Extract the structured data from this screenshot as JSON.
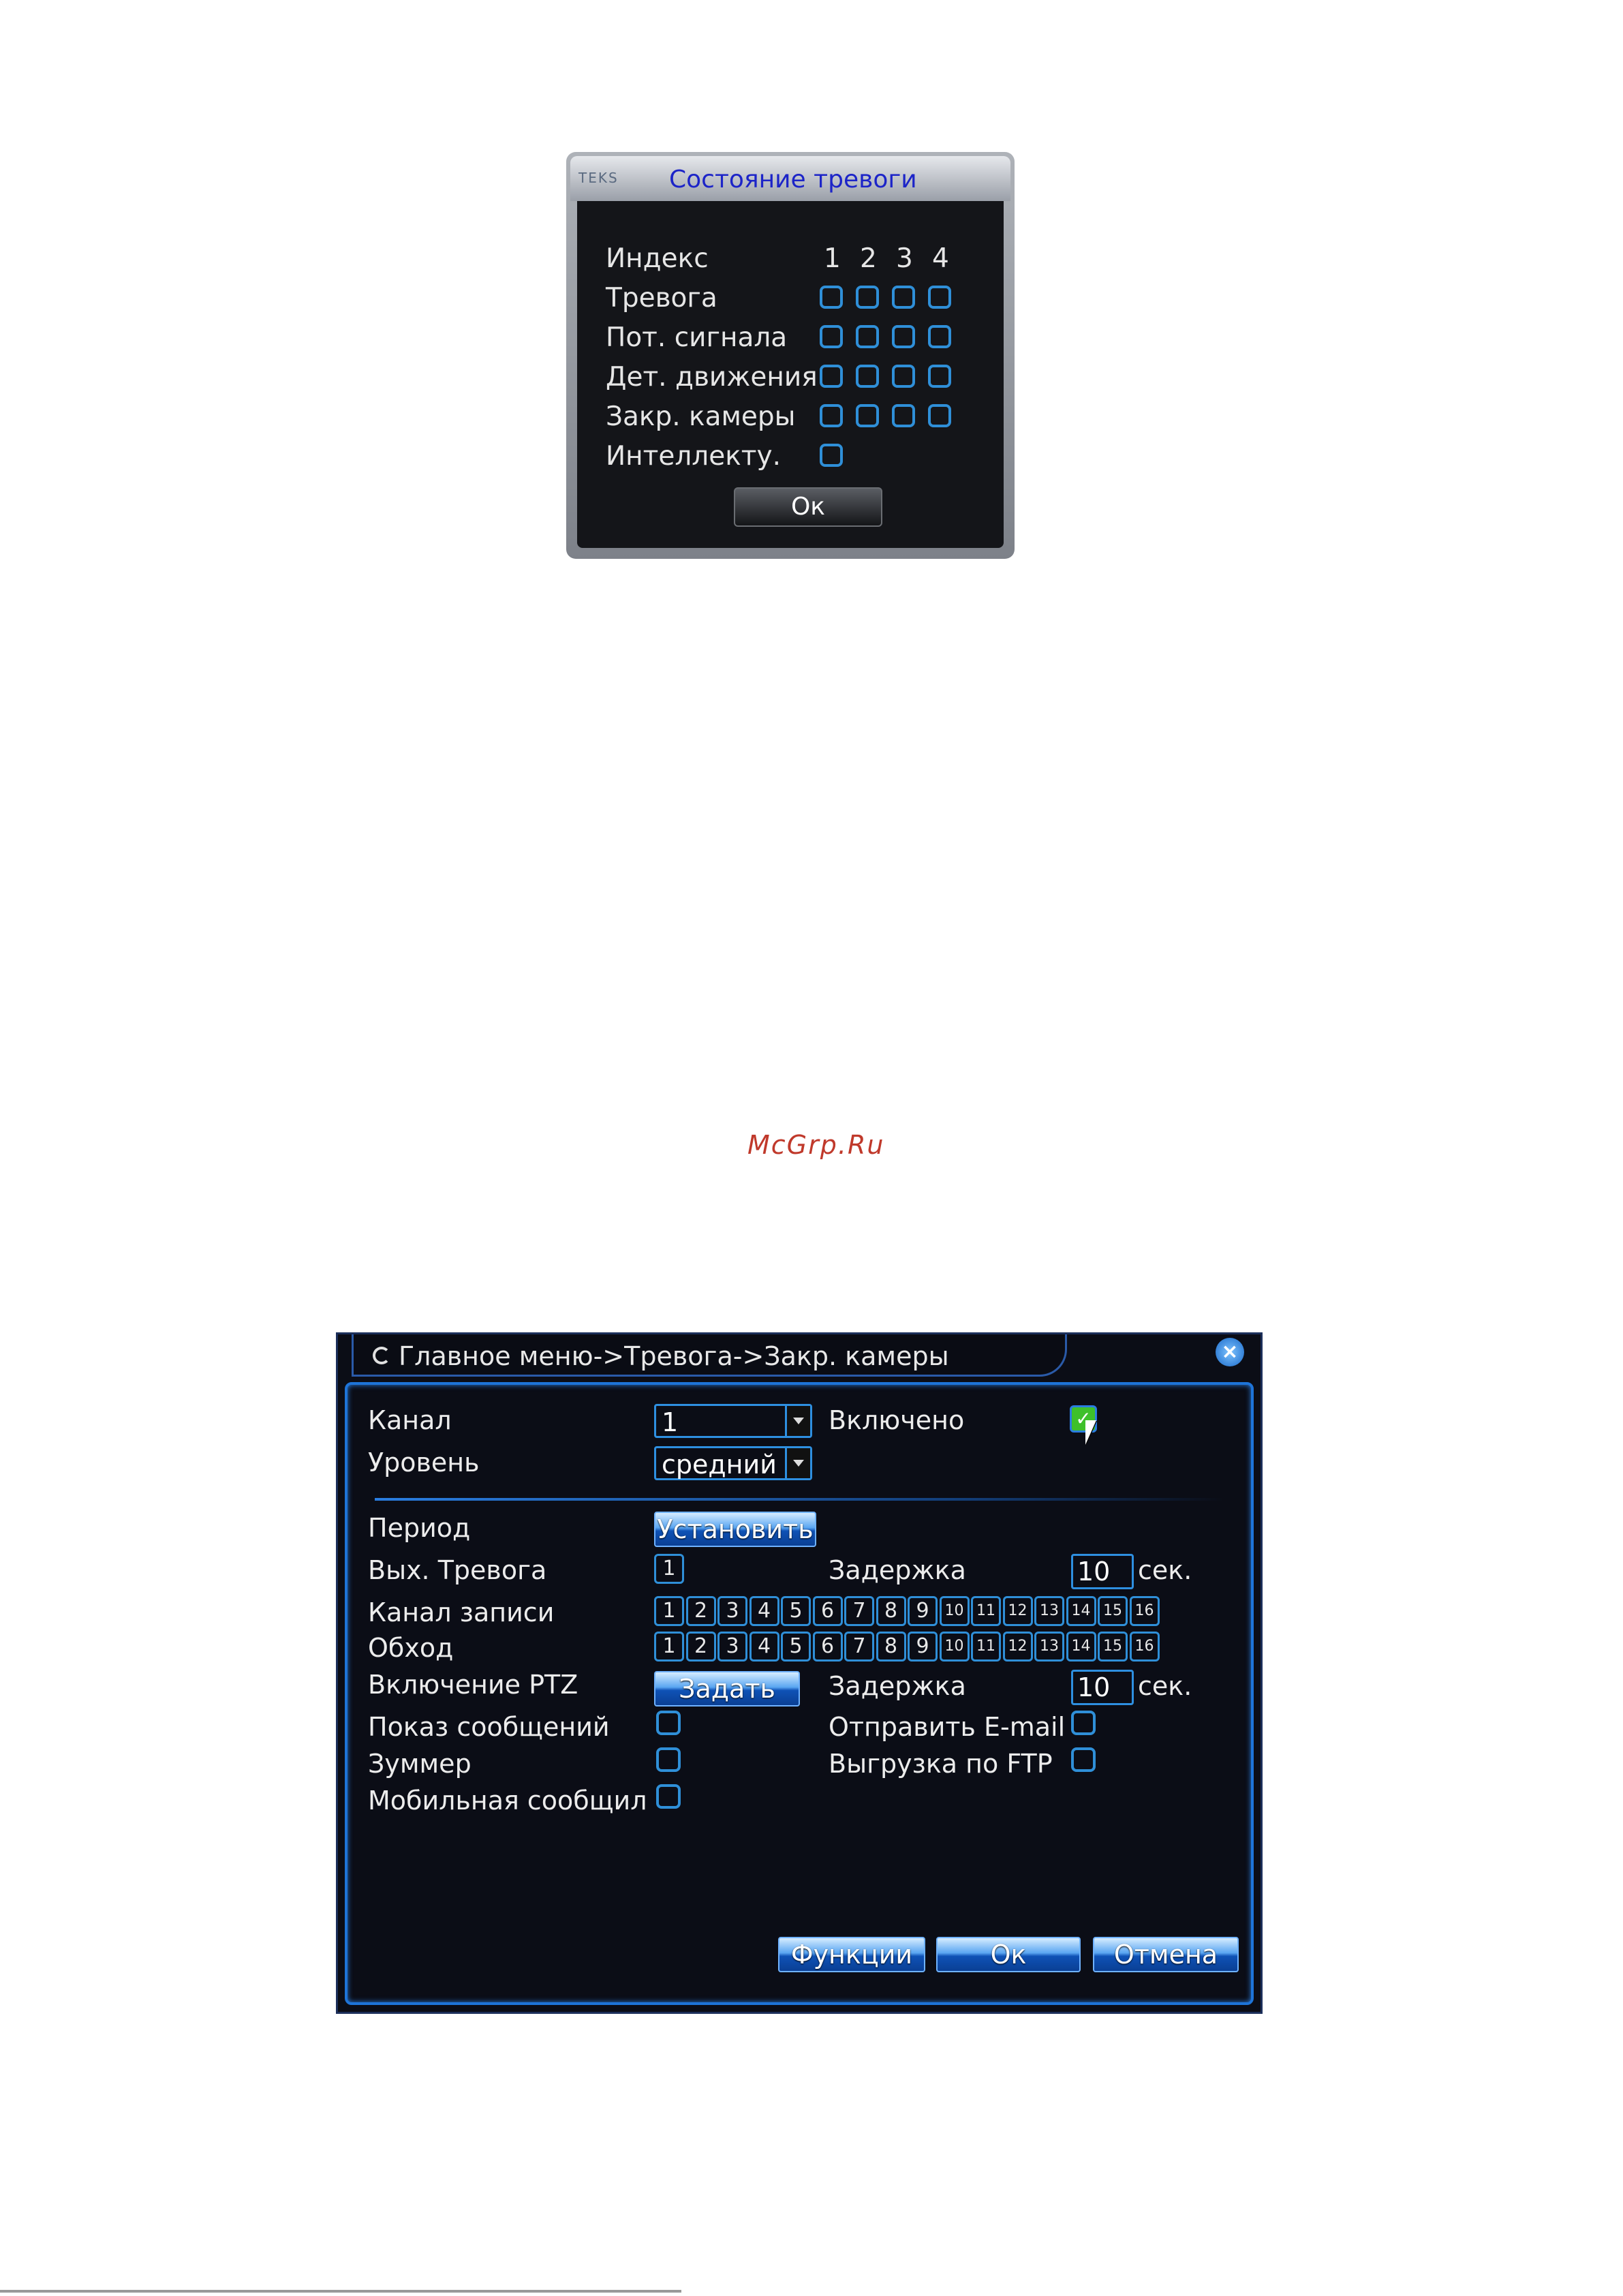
{
  "alarm_status": {
    "logo": "TEKS",
    "title": "Состояние тревоги",
    "index_label": "Индекс",
    "indices": [
      "1",
      "2",
      "3",
      "4"
    ],
    "rows": [
      {
        "label": "Тревога",
        "count": 4
      },
      {
        "label": "Пот. сигнала",
        "count": 4
      },
      {
        "label": "Дет. движения",
        "count": 4
      },
      {
        "label": "Закр. камеры",
        "count": 4
      },
      {
        "label": "Интеллекту.",
        "count": 1
      }
    ],
    "ok_label": "Ок"
  },
  "watermark": "McGrp.Ru",
  "camera_blind": {
    "breadcrumb": "Главное меню->Тревога->Закр. камеры",
    "close_icon": "close-icon",
    "channel_label": "Канал",
    "channel_value": "1",
    "enabled_label": "Включено",
    "enabled_checked": true,
    "level_label": "Уровень",
    "level_value": "средний",
    "period_label": "Период",
    "period_button": "Установить",
    "alarm_out_label": "Вых. Тревога",
    "alarm_out_values": [
      "1"
    ],
    "delay_label_1": "Задержка",
    "delay_value_1": "10",
    "delay_unit_1": "сек.",
    "record_channel_label": "Канал записи",
    "record_channels": [
      "1",
      "2",
      "3",
      "4",
      "5",
      "6",
      "7",
      "8",
      "9",
      "10",
      "11",
      "12",
      "13",
      "14",
      "15",
      "16"
    ],
    "tour_label": "Обход",
    "tour_channels": [
      "1",
      "2",
      "3",
      "4",
      "5",
      "6",
      "7",
      "8",
      "9",
      "10",
      "11",
      "12",
      "13",
      "14",
      "15",
      "16"
    ],
    "ptz_label": "Включение PTZ",
    "ptz_button": "Задать",
    "delay_label_2": "Задержка",
    "delay_value_2": "10",
    "delay_unit_2": "сек.",
    "show_message_label": "Показ сообщений",
    "send_email_label": "Отправить E-mail",
    "buzzer_label": "Зуммер",
    "ftp_upload_label": "Выгрузка по FTP",
    "mobile_message_label": "Мобильная сообщил",
    "functions_button": "Функции",
    "ok_button": "Ок",
    "cancel_button": "Отмена"
  }
}
